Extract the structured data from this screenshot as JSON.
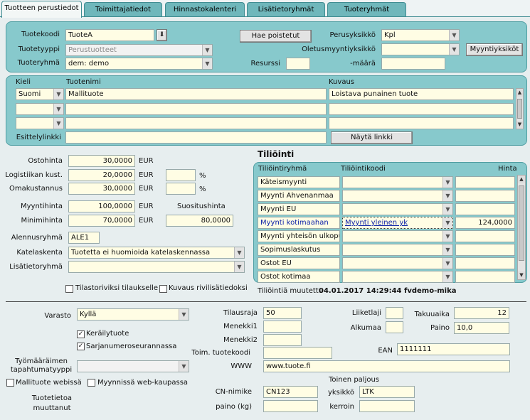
{
  "tabs": [
    "Tuotteen perustiedot",
    "Toimittajatiedot",
    "Hinnastokalenteri",
    "Lisätietoryhmät",
    "Tuoteryhmät"
  ],
  "top": {
    "code_label": "Tuotekoodi",
    "code_value": "TuoteA",
    "type_label": "Tuotetyyppi",
    "type_value": "Perustuotteet",
    "group_label": "Tuoteryhmä",
    "group_value": "dem: demo",
    "fetch_deleted": "Hae poistetut",
    "base_unit_label": "Perusyksikkö",
    "base_unit_value": "Kpl",
    "default_sales_unit_label": "Oletusmyyntiyksikkö",
    "default_sales_unit_value": "",
    "sales_units_button": "Myyntiyksiköt",
    "resource_label": "Resurssi",
    "resource_value": "",
    "amount_label": "-määrä",
    "amount_value": ""
  },
  "lang": {
    "col_language": "Kieli",
    "col_name": "Tuotenimi",
    "col_description": "Kuvaus",
    "rows": [
      {
        "language": "Suomi",
        "name": "Mallituote",
        "description": "Loistava punainen tuote"
      },
      {
        "language": "",
        "name": "",
        "description": ""
      },
      {
        "language": "",
        "name": "",
        "description": ""
      }
    ],
    "intro_link_label": "Esittelylinkki",
    "intro_link_value": "",
    "show_link_button": "Näytä linkki"
  },
  "prices": {
    "purchase_label": "Ostohinta",
    "purchase_value": "30,0000",
    "purchase_cur": "EUR",
    "logistics_label": "Logistiikan kust.",
    "logistics_value": "20,0000",
    "logistics_cur": "EUR",
    "logistics_pct": "",
    "pct_sign": "%",
    "own_cost_label": "Omakustannus",
    "own_cost_value": "30,0000",
    "own_cost_cur": "EUR",
    "own_cost_pct": "",
    "sale_label": "Myyntihinta",
    "sale_value": "100,0000",
    "sale_cur": "EUR",
    "recommended_label": "Suositushinta",
    "recommended_value": "80,0000",
    "min_label": "Minimihinta",
    "min_value": "70,0000",
    "min_cur": "EUR",
    "discount_group_label": "Alennusryhmä",
    "discount_group_value": "ALE1",
    "margin_calc_label": "Katelaskenta",
    "margin_calc_value": "Tuotetta ei huomioida katelaskennassa",
    "extra_group_label": "Lisätietoryhmä",
    "extra_group_value": "",
    "stat_label": "Tilastoriviksi tilaukselle",
    "desc_rows_label": "Kuvaus rivilisätiedoksi"
  },
  "accounting": {
    "title": "Tiliöinti",
    "col_group": "Tiliöintiryhmä",
    "col_code": "Tiliöintikoodi",
    "col_price": "Hinta",
    "rows": [
      {
        "group": "Käteismyynti",
        "code": "",
        "price": "",
        "selected": false
      },
      {
        "group": "Myynti Ahvenanmaa",
        "code": "",
        "price": "",
        "selected": false
      },
      {
        "group": "Myynti EU",
        "code": "",
        "price": "",
        "selected": false
      },
      {
        "group": "Myynti kotimaahan",
        "code": "Myynti yleinen yk",
        "price": "124,0000",
        "selected": true
      },
      {
        "group": "Myynti yhteisön ulkopuo",
        "code": "",
        "price": "",
        "selected": false
      },
      {
        "group": "Sopimuslaskutus",
        "code": "",
        "price": "",
        "selected": false
      },
      {
        "group": "Ostot EU",
        "code": "",
        "price": "",
        "selected": false
      },
      {
        "group": "Ostot kotimaa",
        "code": "",
        "price": "",
        "selected": false
      }
    ],
    "modified_label": "Tiliöintiä muutettu",
    "modified_value": "04.01.2017 14:29:44  fvdemo-mika"
  },
  "bottom": {
    "warehouse_label": "Varasto",
    "warehouse_value": "Kyllä",
    "collect_label": "Keräilytuote",
    "collect_checked": true,
    "serial_label": "Sarjanumeroseurannassa",
    "serial_checked": true,
    "work_order_label": "Työmääräimen tapahtumatyyppi",
    "work_order_value": "",
    "webshop_sample_label": "Mallituote webissä",
    "webshop_sale_label": "Myynnissä web-kaupassa",
    "info_modified_label": "Tuotetietoa muuttanut",
    "order_limit_label": "Tilausraja",
    "order_limit_value": "50",
    "menekki1_label": "Menekki1",
    "menekki1_value": "",
    "menekki2_label": "Menekki2",
    "menekki2_value": "",
    "supplier_code_label": "Toim. tuotekoodi",
    "supplier_code_value": "",
    "www_label": "WWW",
    "www_value": "www.tuote.fi",
    "cn_label": "CN-nimike",
    "cn_value": "CN123",
    "weight_kg_label": "paino (kg)",
    "weight_kg_value": "",
    "business_label": "Liiketlaji",
    "business_value": "",
    "origin_label": "Alkumaa",
    "origin_value": "",
    "warranty_label": "Takuuaika",
    "warranty_value": "12",
    "weight_label": "Paino",
    "weight_value": "10,0",
    "ean_label": "EAN",
    "ean_value": "1111111",
    "second_weight_label": "Toinen paljous",
    "unit_label": "yksikkö",
    "unit_value": "LTK",
    "factor_label": "kerroin",
    "factor_value": ""
  }
}
